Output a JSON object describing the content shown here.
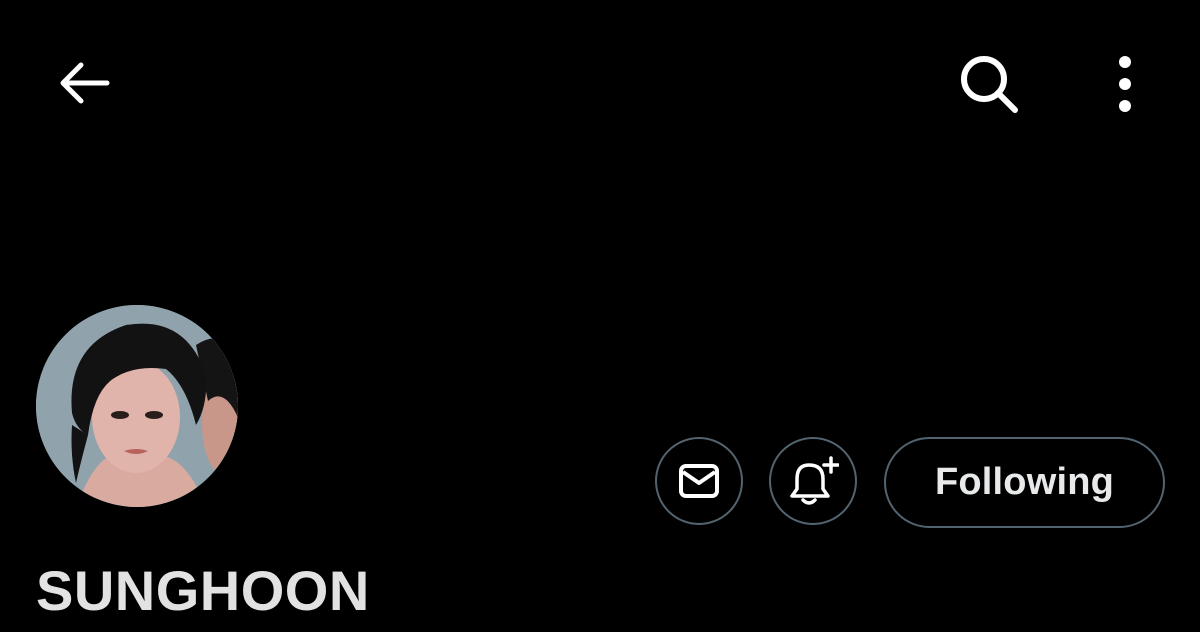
{
  "header": {
    "back_icon": "arrow-left-icon",
    "search_icon": "search-icon",
    "more_icon": "more-vertical-icon"
  },
  "profile": {
    "display_name": "SUNGHOON",
    "avatar_icon": "avatar",
    "accent_border": "#536471",
    "background": "#000000"
  },
  "actions": {
    "message_icon": "mail-icon",
    "notify_icon": "bell-plus-icon",
    "following_label": "Following"
  }
}
